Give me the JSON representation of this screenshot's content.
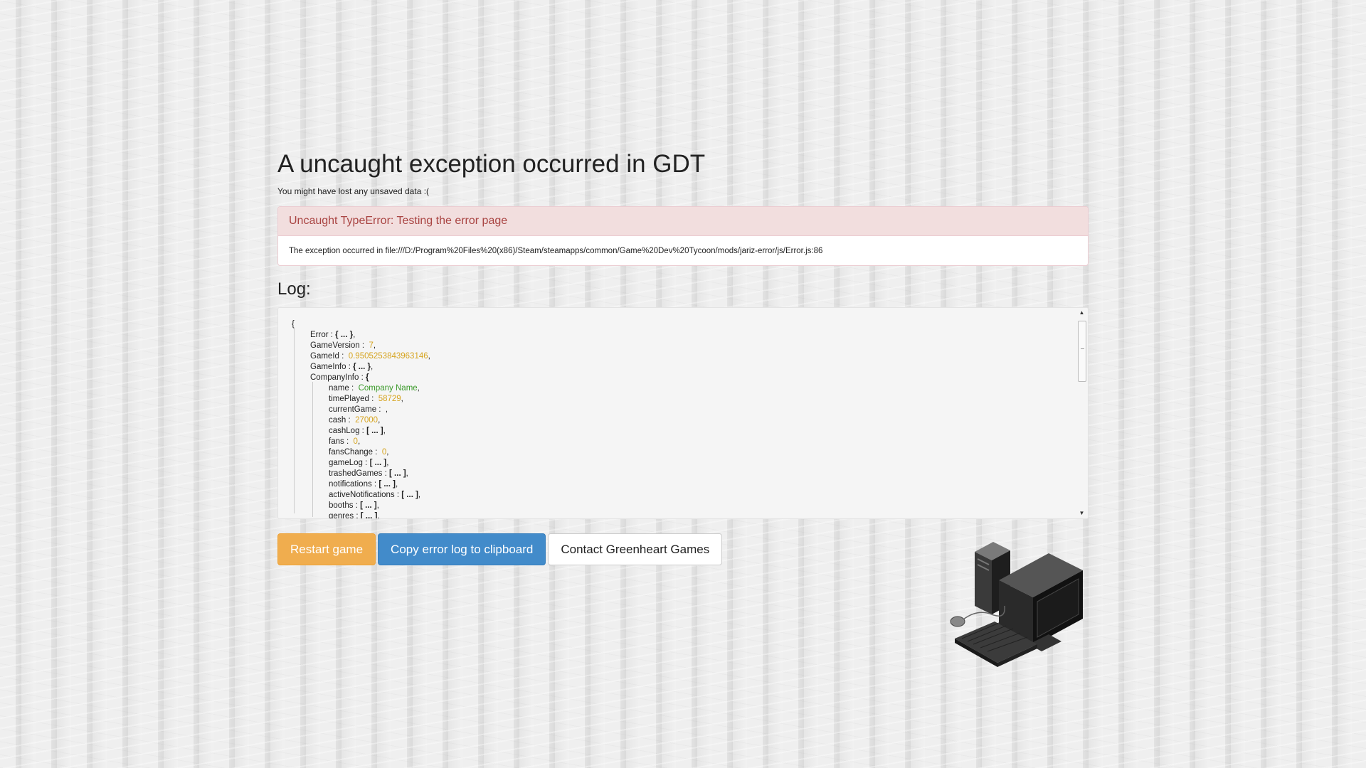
{
  "page": {
    "title": "A uncaught exception occurred in GDT",
    "subtitle": "You might have lost any unsaved data :("
  },
  "error": {
    "heading": "Uncaught TypeError: Testing the error page",
    "detail": "The exception occurred in file:///D:/Program%20Files%20(x86)/Steam/steamapps/common/Game%20Dev%20Tycoon/mods/jariz-error/js/Error.js:86"
  },
  "log": {
    "heading": "Log:",
    "open_brace": "{",
    "top_entries": [
      {
        "key": "Error",
        "value": "{ ... }",
        "kind": "obj"
      },
      {
        "key": "GameVersion",
        "value": "7",
        "kind": "num"
      },
      {
        "key": "GameId",
        "value": "0.9505253843963146",
        "kind": "num"
      },
      {
        "key": "GameInfo",
        "value": "{ ... }",
        "kind": "obj"
      }
    ],
    "company_key": "CompanyInfo",
    "company_entries": [
      {
        "key": "name",
        "value": "Company Name",
        "kind": "str"
      },
      {
        "key": "timePlayed",
        "value": "58729",
        "kind": "num"
      },
      {
        "key": "currentGame",
        "value": "",
        "kind": "str"
      },
      {
        "key": "cash",
        "value": "27000",
        "kind": "num"
      },
      {
        "key": "cashLog",
        "value": "[ ... ]",
        "kind": "obj"
      },
      {
        "key": "fans",
        "value": "0",
        "kind": "num"
      },
      {
        "key": "fansChange",
        "value": "0",
        "kind": "num"
      },
      {
        "key": "gameLog",
        "value": "[ ... ]",
        "kind": "obj"
      },
      {
        "key": "trashedGames",
        "value": "[ ... ]",
        "kind": "obj"
      },
      {
        "key": "notifications",
        "value": "[ ... ]",
        "kind": "obj"
      },
      {
        "key": "activeNotifications",
        "value": "[ ... ]",
        "kind": "obj"
      },
      {
        "key": "booths",
        "value": "[ ... ]",
        "kind": "obj"
      },
      {
        "key": "genres",
        "value": "[ ... ]",
        "kind": "obj"
      }
    ]
  },
  "buttons": {
    "restart": "Restart game",
    "copy": "Copy error log to clipboard",
    "contact": "Contact Greenheart Games"
  },
  "colors": {
    "warning": "#f0ad4e",
    "primary": "#428bca",
    "danger_bg": "#f2dede",
    "danger_text": "#a94442",
    "num": "#d6a41f",
    "str": "#3b9a2a"
  },
  "illustration": {
    "icon": "computer-desktop-icon"
  }
}
